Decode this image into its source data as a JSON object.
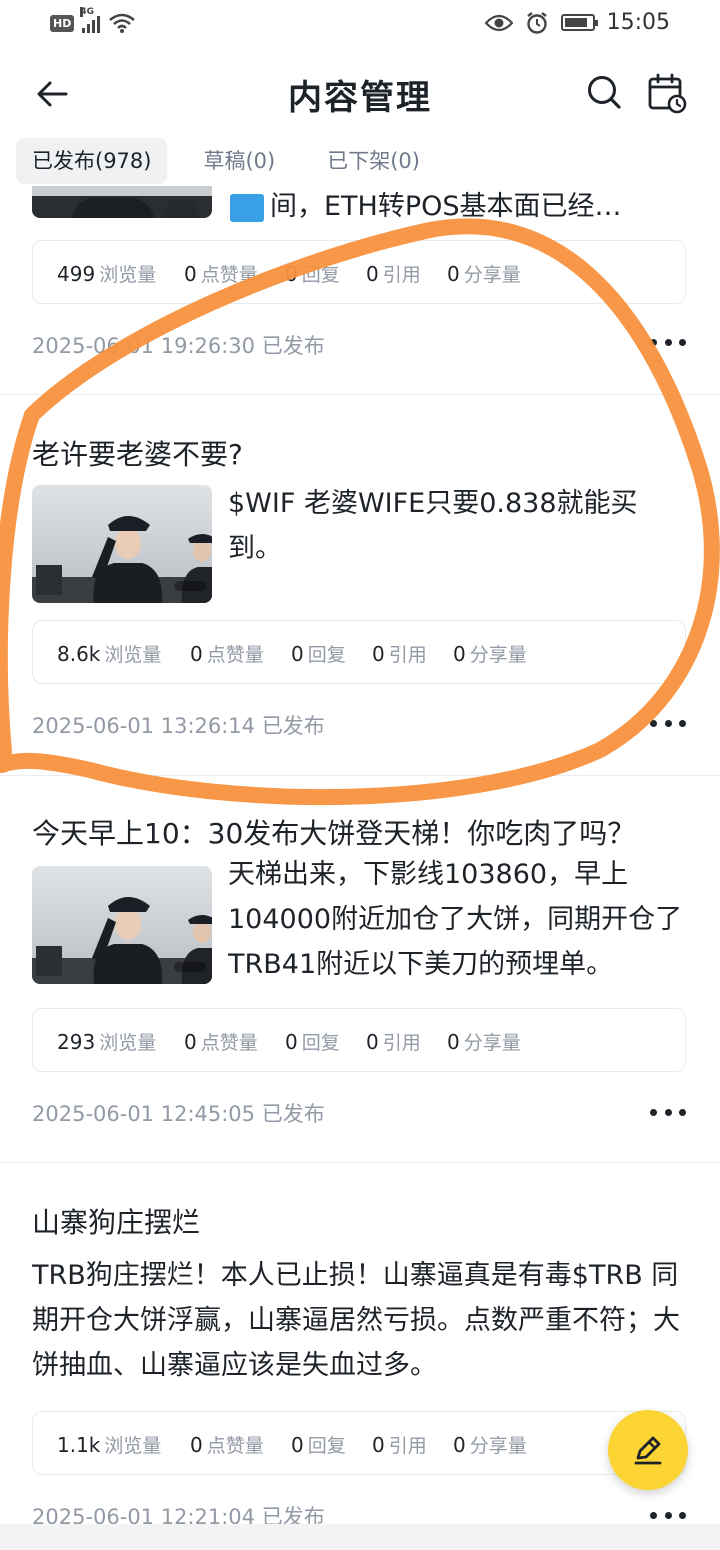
{
  "status_bar": {
    "hd": "HD",
    "network": "4G",
    "time": "15:05",
    "battery_level": 0.85
  },
  "header": {
    "title": "内容管理",
    "icons": [
      "back-arrow-icon",
      "search-icon",
      "calendar-clock-icon"
    ]
  },
  "tabs": [
    {
      "label": "已发布(978)",
      "active": true
    },
    {
      "label": "草稿(0)",
      "active": false
    },
    {
      "label": "已下架(0)",
      "active": false
    }
  ],
  "stat_labels": {
    "views": "浏览量",
    "likes": "点赞量",
    "replies": "回复",
    "quotes": "引用",
    "shares": "分享量"
  },
  "posts": [
    {
      "excerpt_tail": "间，ETH转POS基本面已经…",
      "stats": {
        "views": "499",
        "likes": "0",
        "replies": "0",
        "quotes": "0",
        "shares": "0"
      },
      "date": "2025-06-01 19:26:30 已发布"
    },
    {
      "title": "老许要老婆不要?",
      "excerpt": "$WIF 老婆WIFE只要0.838就能买到。",
      "stats": {
        "views": "8.6k",
        "likes": "0",
        "replies": "0",
        "quotes": "0",
        "shares": "0"
      },
      "date": "2025-06-01 13:26:14 已发布"
    },
    {
      "title": "今天早上10：30发布大饼登天梯！你吃肉了吗？",
      "excerpt": "天梯出来，下影线103860，早上104000附近加仓了大饼，同期开仓了TRB41附近以下美刀的预埋单。",
      "stats": {
        "views": "293",
        "likes": "0",
        "replies": "0",
        "quotes": "0",
        "shares": "0"
      },
      "date": "2025-06-01 12:45:05 已发布"
    },
    {
      "title": "山寨狗庄摆烂",
      "excerpt": "TRB狗庄摆烂！本人已止损！山寨逼真是有毒$TRB 同期开仓大饼浮赢，山寨逼居然亏损。点数严重不符；大饼抽血、山寨逼应该是失血过多。",
      "stats": {
        "views": "1.1k",
        "likes": "0",
        "replies": "0",
        "quotes": "0",
        "shares": "0"
      },
      "date": "2025-06-01 12:21:04 已发布"
    }
  ],
  "colors": {
    "accent": "#fcd535",
    "annotation": "#f7913d",
    "text_primary": "#1e2329",
    "text_secondary": "#929aa5"
  }
}
